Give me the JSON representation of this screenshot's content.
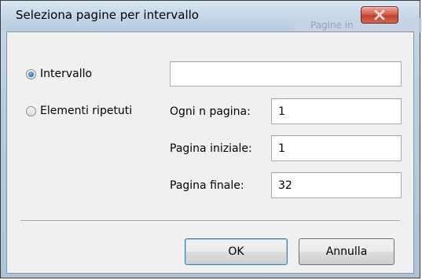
{
  "window": {
    "title": "Seleziona pagine per intervallo",
    "background_hint": "Pagine in"
  },
  "options": {
    "interval": {
      "label": "Intervallo",
      "selected": true,
      "value": ""
    },
    "repeated": {
      "label": "Elementi ripetuti",
      "selected": false
    }
  },
  "fields": {
    "every_n": {
      "label": "Ogni n pagina:",
      "value": "1"
    },
    "start_page": {
      "label": "Pagina iniziale:",
      "value": "1"
    },
    "end_page": {
      "label": "Pagina finale:",
      "value": "32"
    }
  },
  "buttons": {
    "ok": "OK",
    "cancel": "Annulla"
  },
  "icons": {
    "close": "close-icon"
  },
  "colors": {
    "close_red": "#c1402d",
    "radio_blue": "#2a6ec2"
  }
}
